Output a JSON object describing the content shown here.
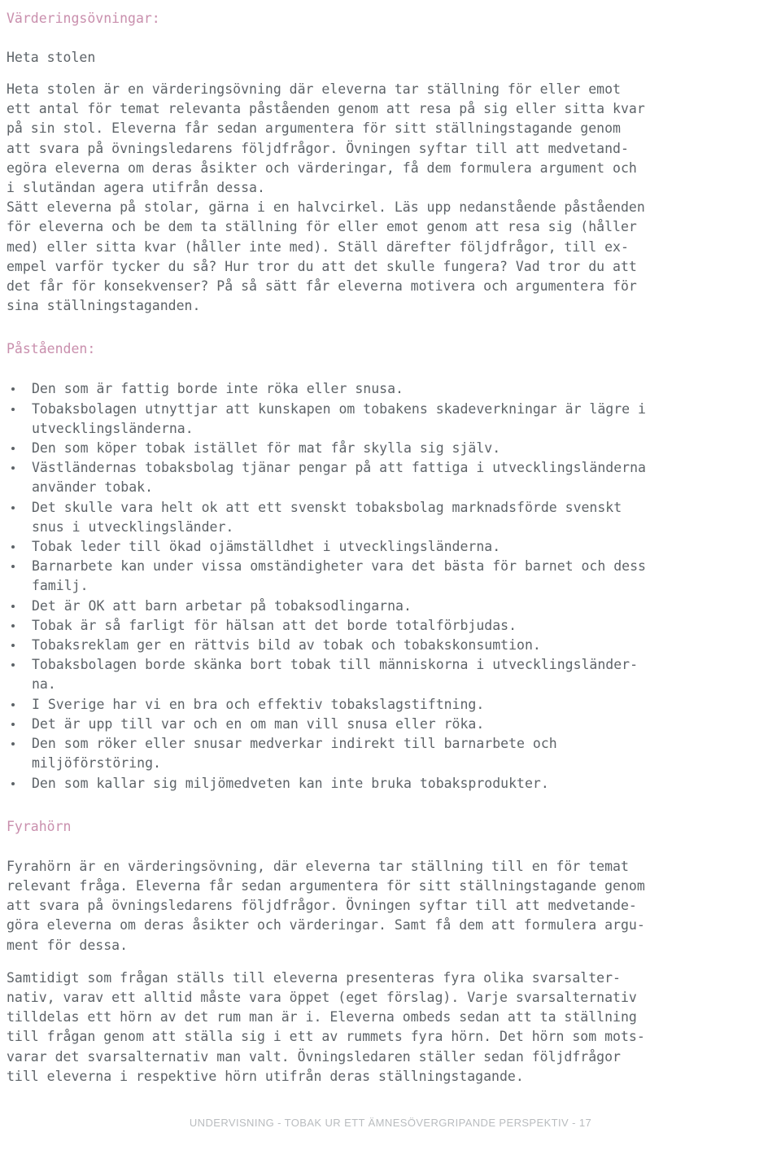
{
  "document": {
    "title": "Värderingsövningar:",
    "sections": [
      {
        "id": "heta-stolen",
        "subtitle": "Heta stolen",
        "paragraphs": [
          "Heta stolen är en värderingsövning där eleverna tar ställning för eller emot\nett antal för temat relevanta påståenden genom att resa på sig eller sitta kvar\npå sin stol. Eleverna får sedan argumentera för sitt ställningstagande genom\natt svara på övningsledarens följdfrågor. Övningen syftar till att medvetand-\negöra eleverna om deras åsikter och värderingar, få dem formulera argument och\ni slutändan agera utifrån dessa.",
          "Sätt eleverna på stolar, gärna i en halvcirkel. Läs upp nedanstående påståenden\nför eleverna och be dem ta ställning för eller emot genom att resa sig (håller\nmed) eller sitta kvar (håller inte med). Ställ därefter följdfrågor, till ex-\nempel varför tycker du så? Hur tror du att det skulle fungera? Vad tror du att\ndet får för konsekvenser? På så sätt får eleverna motivera och argumentera för\nsina ställningstaganden."
        ],
        "list_heading": "Påståenden:",
        "bullets": [
          "Den som är fattig borde inte röka eller snusa.",
          "Tobaksbolagen utnyttjar att kunskapen om tobakens skadeverkningar är lägre i\nutvecklingsländerna.",
          "Den som köper tobak istället för mat får skylla sig själv.",
          "Västländernas tobaksbolag tjänar pengar på att fattiga i utvecklingsländerna\nanvänder tobak.",
          "Det skulle vara helt ok att ett svenskt tobaksbolag marknadsförde svenskt\nsnus i utvecklingsländer.",
          "Tobak leder till ökad ojämställdhet i utvecklingsländerna.",
          "Barnarbete kan under vissa omständigheter vara det bästa för barnet och dess\nfamilj.",
          "Det är OK att barn arbetar på tobaksodlingarna.",
          "Tobak är så farligt för hälsan att det borde totalförbjudas.",
          "Tobaksreklam ger en rättvis bild av tobak och tobakskonsumtion.",
          "Tobaksbolagen borde skänka bort tobak till människorna i utvecklingsländer-\nna.",
          "I Sverige har vi en bra och effektiv tobakslagstiftning.",
          "Det är upp till var och en om man vill snusa eller röka.",
          "Den som röker eller snusar medverkar indirekt till barnarbete och\nmiljöförstöring.",
          "Den som kallar sig miljömedveten kan inte bruka tobaksprodukter."
        ]
      },
      {
        "id": "fyrahorn",
        "heading": "Fyrahörn",
        "paragraphs": [
          "Fyrahörn är en värderingsövning, där eleverna tar ställning till en för temat\nrelevant fråga. Eleverna får sedan argumentera för sitt ställningstagande genom\natt svara på övningsledarens följdfrågor. Övningen syftar till att medvetande-\ngöra eleverna om deras åsikter och värderingar. Samt få dem att formulera argu-\nment för dessa.",
          "Samtidigt som frågan ställs till eleverna presenteras fyra olika svarsalter-\nnativ, varav ett alltid måste vara öppet (eget förslag). Varje svarsalternativ\ntilldelas ett hörn av det rum man är i. Eleverna ombeds sedan att ta ställning\ntill frågan genom att ställa sig i ett av rummets fyra hörn. Det hörn som mots-\nvarar det svarsalternativ man valt. Övningsledaren ställer sedan följdfrågor\ntill eleverna i respektive hörn utifrån deras ställningstagande."
        ]
      }
    ],
    "footer": "UNDERVISNING - TOBAK UR ETT ÄMNESÖVERGRIPANDE PERSPEKTIV - 17"
  },
  "colors": {
    "heading_pink": "#c98fad",
    "body_gray": "#5d6368",
    "footer_gray": "#b9bcbf",
    "background": "#ffffff"
  }
}
